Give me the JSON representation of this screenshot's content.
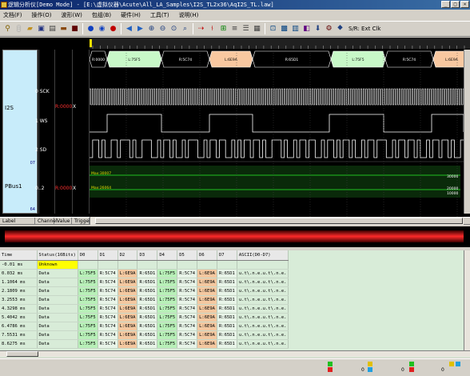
{
  "window": {
    "title": "逻辑分析仪[Demo Mode] - [E:\\虚拟仪器\\Acute\\All_LA_Samples\\I2S_TL2x36\\AqI2S_TL.law]"
  },
  "menu": [
    "文档(F)",
    "操作(O)",
    "波形(W)",
    "包组(B)",
    "硬件(H)",
    "工具(T)",
    "说明(H)"
  ],
  "toolbar": {
    "ext_clock_label": "S/R: Ext Clk",
    "icons": [
      "pin-icon",
      "new-icon",
      "open-icon",
      "save-icon",
      "print-icon",
      "folder-icon",
      "cut-icon",
      "run-icon",
      "run-once-icon",
      "stop-icon",
      "back-icon",
      "forward-icon",
      "zoom-in-icon",
      "zoom-out-icon",
      "zoom-fit-icon",
      "zoom-menu-icon",
      "cursor-icon",
      "trigger-icon",
      "add-channel-icon",
      "bus-icon",
      "list-icon",
      "calc-icon",
      "measure-icon",
      "grid-icon",
      "table-icon",
      "color-icon",
      "arrow-down-icon",
      "settings-icon",
      "save-wave-icon"
    ]
  },
  "signals": {
    "group_label": "I2S",
    "group_count": "07",
    "bus_label": "PBus1",
    "bus_count": "64",
    "channels": [
      {
        "name": "0 SCK",
        "value": "",
        "trigger": ""
      },
      {
        "name": "1 WS",
        "value": "",
        "trigger": ""
      },
      {
        "name": "2 SD",
        "value": "",
        "trigger": ""
      },
      {
        "name": "0..2",
        "value": "",
        "trigger": "X"
      }
    ],
    "group_value": "R:0000",
    "group_trigger": "X",
    "bus_value": "R:0000",
    "bus_trigger": "X"
  },
  "decode_bar": {
    "segments": [
      {
        "label": "R:0000",
        "color": "#000000",
        "text_color": "#ffffff"
      },
      {
        "label": "L:75F5",
        "color": "#c8f8c8",
        "text_color": "#000000"
      },
      {
        "label": "R:5C74",
        "color": "#000000",
        "text_color": "#ffffff"
      },
      {
        "label": "L:6E9A",
        "color": "#f8c8a0",
        "text_color": "#000000"
      },
      {
        "label": "R:65D1",
        "color": "#000000",
        "text_color": "#ffffff"
      },
      {
        "label": "L:75F5",
        "color": "#c8f8c8",
        "text_color": "#000000"
      },
      {
        "label": "R:5C74",
        "color": "#000000",
        "text_color": "#ffffff"
      },
      {
        "label": "L:6E9A",
        "color": "#f8c8a0",
        "text_color": "#000000"
      }
    ]
  },
  "bus_analog": {
    "line1_label": "Max:30007",
    "line2_label": "Max:26064",
    "right1": "30000",
    "right2": "20000",
    "right3": "10000"
  },
  "column_headers": {
    "label": "Label",
    "channel": "Channel",
    "value": "Value",
    "trigger": "Trigger"
  },
  "table": {
    "headers": [
      "Time",
      "Status(16Bits)",
      "D0",
      "D1",
      "D2",
      "D3",
      "D4",
      "D5",
      "D6",
      "D7",
      "ASCII(D0-D7)"
    ],
    "rows": [
      {
        "time": "-0.01 ms",
        "status": "Unknown",
        "d": [
          "",
          "",
          "",
          "",
          "",
          "",
          "",
          ""
        ],
        "ascii": "",
        "unknown": true
      },
      {
        "time": "0.032 ms",
        "status": "Data",
        "d": [
          "L:75F5",
          "R:5C74",
          "L:6E9A",
          "R:65D1",
          "L:75F5",
          "R:5C74",
          "L:6E9A",
          "R:65D1"
        ],
        "ascii": "u.t\\.n.e.u.t\\.n.e."
      },
      {
        "time": "1.1064 ms",
        "status": "Data",
        "d": [
          "L:75F5",
          "R:5C74",
          "L:6E9A",
          "R:65D1",
          "L:75F5",
          "R:5C74",
          "L:6E9A",
          "R:65D1"
        ],
        "ascii": "u.t\\.n.e.u.t\\.n.e."
      },
      {
        "time": "2.1809 ms",
        "status": "Data",
        "d": [
          "L:75F5",
          "R:5C74",
          "L:6E9A",
          "R:65D1",
          "L:75F5",
          "R:5C74",
          "L:6E9A",
          "R:65D1"
        ],
        "ascii": "u.t\\.n.e.u.t\\.n.e."
      },
      {
        "time": "3.2553 ms",
        "status": "Data",
        "d": [
          "L:75F5",
          "R:5C74",
          "L:6E9A",
          "R:65D1",
          "L:75F5",
          "R:5C74",
          "L:6E9A",
          "R:65D1"
        ],
        "ascii": "u.t\\.n.e.u.t\\.n.e."
      },
      {
        "time": "4.3298 ms",
        "status": "Data",
        "d": [
          "L:75F5",
          "R:5C74",
          "L:6E9A",
          "R:65D1",
          "L:75F5",
          "R:5C74",
          "L:6E9A",
          "R:65D1"
        ],
        "ascii": "u.t\\.n.e.u.t\\.n.e."
      },
      {
        "time": "5.4042 ms",
        "status": "Data",
        "d": [
          "L:75F5",
          "R:5C74",
          "L:6E9A",
          "R:65D1",
          "L:75F5",
          "R:5C74",
          "L:6E9A",
          "R:65D1"
        ],
        "ascii": "u.t\\.n.e.u.t\\.n.e."
      },
      {
        "time": "6.4786 ms",
        "status": "Data",
        "d": [
          "L:75F5",
          "R:5C74",
          "L:6E9A",
          "R:65D1",
          "L:75F5",
          "R:5C74",
          "L:6E9A",
          "R:65D1"
        ],
        "ascii": "u.t\\.n.e.u.t\\.n.e."
      },
      {
        "time": "7.5531 ms",
        "status": "Data",
        "d": [
          "L:75F5",
          "R:5C74",
          "L:6E9A",
          "R:65D1",
          "L:75F5",
          "R:5C74",
          "L:6E9A",
          "R:65D1"
        ],
        "ascii": "u.t\\.n.e.u.t\\.n.e."
      },
      {
        "time": "8.6275 ms",
        "status": "Data",
        "d": [
          "L:75F5",
          "R:5C74",
          "L:6E9A",
          "R:65D1",
          "L:75F5",
          "R:5C74",
          "L:6E9A",
          "R:65D1"
        ],
        "ascii": "u.t\\.n.e.u.t\\.n.e."
      }
    ]
  },
  "status_bar": {
    "count_a": "0",
    "count_b": "0",
    "count_c": "0"
  }
}
